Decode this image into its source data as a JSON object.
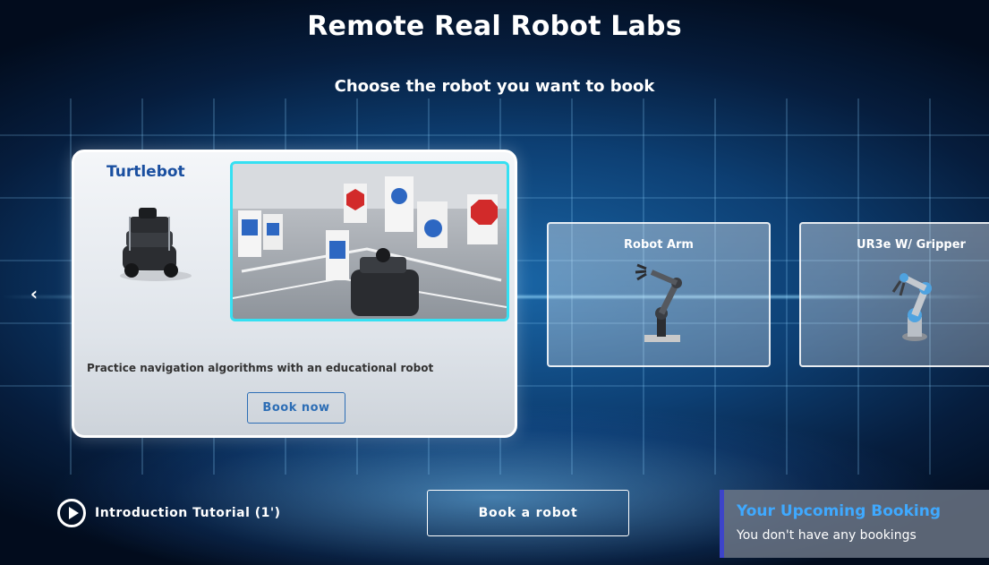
{
  "header": {
    "title": "Remote Real Robot Labs",
    "subtitle": "Choose the robot you want to book"
  },
  "carousel": {
    "prev_icon": "chevron-left-icon",
    "featured": {
      "name": "Turtlebot",
      "description": "Practice navigation algorithms with an educational robot",
      "button_label": "Book now",
      "accent_color": "#35e0f2"
    },
    "others": [
      {
        "name": "Robot Arm"
      },
      {
        "name": "UR3e W/ Gripper"
      }
    ]
  },
  "footer": {
    "tutorial_label": "Introduction Tutorial (1')",
    "book_button_label": "Book a robot",
    "booking": {
      "title": "Your Upcoming Booking",
      "empty_text": "You don't have any bookings",
      "title_color": "#3fa9ff",
      "accent_color": "#3d44c9"
    }
  }
}
